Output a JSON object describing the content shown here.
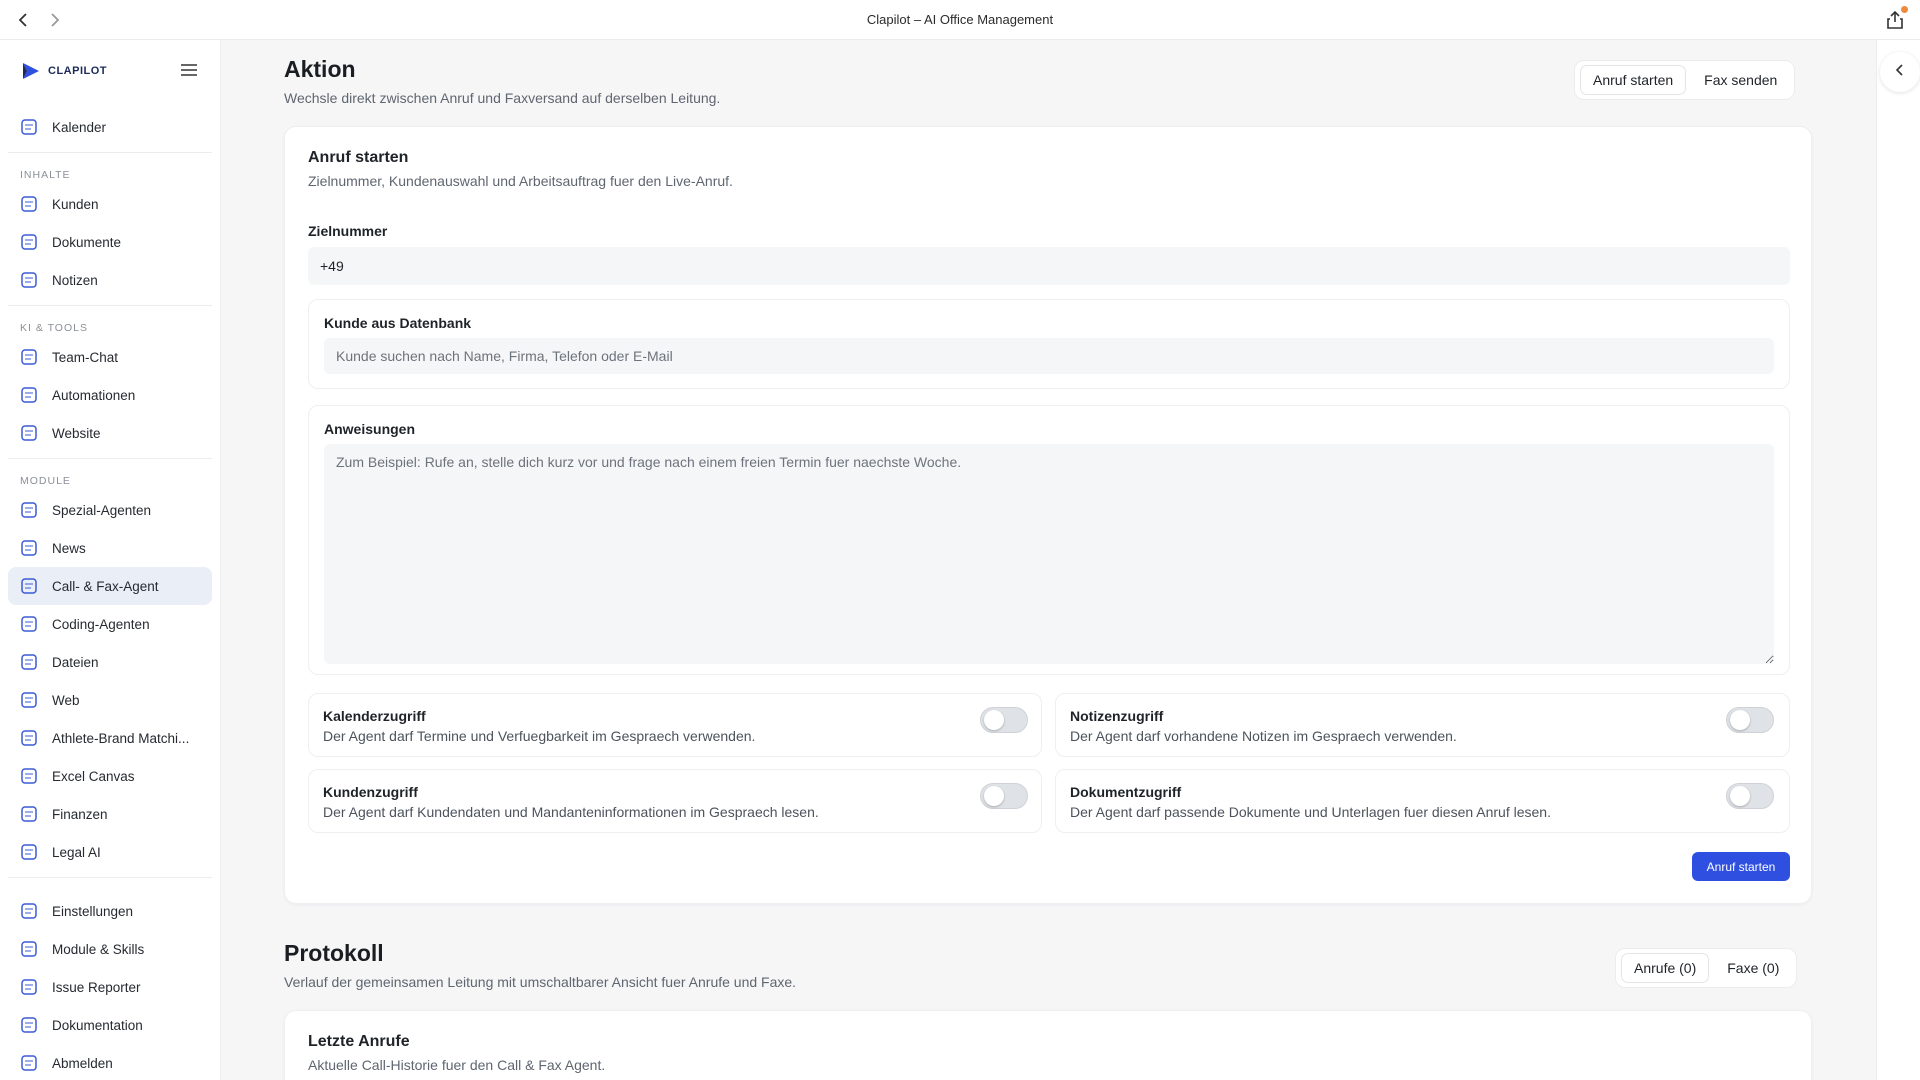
{
  "window": {
    "title": "Clapilot – AI Office Management"
  },
  "brand": {
    "name": "CLAPILOT"
  },
  "sidebar": {
    "top_items": [
      {
        "label": "Kalender",
        "icon": "calendar-icon"
      }
    ],
    "sections": [
      {
        "title": "INHALTE",
        "items": [
          {
            "label": "Kunden",
            "icon": "customers-icon"
          },
          {
            "label": "Dokumente",
            "icon": "documents-icon"
          },
          {
            "label": "Notizen",
            "icon": "notes-icon"
          }
        ]
      },
      {
        "title": "KI & TOOLS",
        "items": [
          {
            "label": "Team-Chat",
            "icon": "chat-icon"
          },
          {
            "label": "Automationen",
            "icon": "automation-icon"
          },
          {
            "label": "Website",
            "icon": "website-icon"
          }
        ]
      },
      {
        "title": "MODULE",
        "items": [
          {
            "label": "Spezial-Agenten",
            "icon": "shield-icon"
          },
          {
            "label": "News",
            "icon": "news-icon"
          },
          {
            "label": "Call- & Fax-Agent",
            "icon": "phone-icon",
            "active": true
          },
          {
            "label": "Coding-Agenten",
            "icon": "code-icon"
          },
          {
            "label": "Dateien",
            "icon": "folder-icon"
          },
          {
            "label": "Web",
            "icon": "browser-icon"
          },
          {
            "label": "Athlete-Brand Matchi...",
            "icon": "match-icon"
          },
          {
            "label": "Excel Canvas",
            "icon": "spreadsheet-icon"
          },
          {
            "label": "Finanzen",
            "icon": "finance-icon"
          },
          {
            "label": "Legal AI",
            "icon": "legal-icon"
          }
        ]
      }
    ],
    "bottom_items": [
      {
        "label": "Einstellungen",
        "icon": "gear-icon"
      },
      {
        "label": "Module & Skills",
        "icon": "modules-icon"
      },
      {
        "label": "Issue Reporter",
        "icon": "issue-icon"
      },
      {
        "label": "Dokumentation",
        "icon": "book-icon"
      },
      {
        "label": "Abmelden",
        "icon": "logout-icon"
      }
    ]
  },
  "aktion": {
    "title": "Aktion",
    "subtitle": "Wechsle direkt zwischen Anruf und Faxversand auf derselben Leitung.",
    "tabs": [
      "Anruf starten",
      "Fax senden"
    ]
  },
  "call_form": {
    "title": "Anruf starten",
    "subtitle": "Zielnummer, Kundenauswahl und Arbeitsauftrag fuer den Live-Anruf.",
    "target_label": "Zielnummer",
    "target_value": "+49",
    "customer_label": "Kunde aus Datenbank",
    "customer_placeholder": "Kunde suchen nach Name, Firma, Telefon oder E-Mail",
    "instructions_label": "Anweisungen",
    "instructions_placeholder": "Zum Beispiel: Rufe an, stelle dich kurz vor und frage nach einem freien Termin fuer naechste Woche.",
    "toggles": [
      {
        "title": "Kalenderzugriff",
        "desc": "Der Agent darf Termine und Verfuegbarkeit im Gespraech verwenden.",
        "on": false
      },
      {
        "title": "Notizenzugriff",
        "desc": "Der Agent darf vorhandene Notizen im Gespraech verwenden.",
        "on": false
      },
      {
        "title": "Kundenzugriff",
        "desc": "Der Agent darf Kundendaten und Mandanteninformationen im Gespraech lesen.",
        "on": false
      },
      {
        "title": "Dokumentzugriff",
        "desc": "Der Agent darf passende Dokumente und Unterlagen fuer diesen Anruf lesen.",
        "on": false
      }
    ],
    "submit_label": "Anruf starten"
  },
  "protokoll": {
    "title": "Protokoll",
    "subtitle": "Verlauf der gemeinsamen Leitung mit umschaltbarer Ansicht fuer Anrufe und Faxe.",
    "tabs": [
      "Anrufe (0)",
      "Faxe (0)"
    ],
    "recent_title": "Letzte Anrufe",
    "recent_subtitle": "Aktuelle Call-Historie fuer den Call & Fax Agent."
  },
  "colors": {
    "accent": "#2f4fe0",
    "active_nav": "#e9eef7"
  }
}
